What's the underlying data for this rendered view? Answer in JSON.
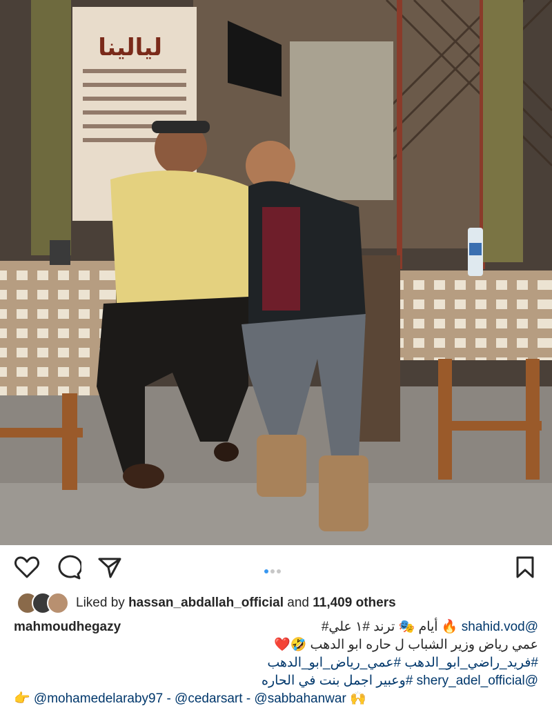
{
  "photo": {
    "shop_sign": "ليالينا",
    "description_icon": "photo-two-men-at-cafe"
  },
  "actions": {
    "like_icon": "heart-icon",
    "comment_icon": "comment-icon",
    "share_icon": "send-icon",
    "save_icon": "bookmark-icon"
  },
  "carousel": {
    "count": 3,
    "active": 1
  },
  "likes": {
    "prefix": "Liked by",
    "user": "hassan_abdallah_official",
    "middle": "and",
    "others": "11,409 others"
  },
  "caption": {
    "username": "mahmoudhegazy",
    "line1_mention": "@shahid.vod",
    "line1_text": "🔥 أيام 🎭 ترند #١ علي#",
    "line2": "عمي رياض وزير الشباب ل حاره ابو الدهب 🤣❤️",
    "line3": "#فريد_راضي_ابو_الدهب #عمي_رياض_ابو_الدهب",
    "line4_text": "#وعبير اجمل بنت في الحاره",
    "line4_mention": "@shery_adel_official",
    "line5": "👉 @mohamedelaraby97 - @cedarsart - @sabbahanwar 🙌"
  },
  "colors": {
    "accent": "#3897f0",
    "link": "#00376b",
    "text": "#262626"
  }
}
